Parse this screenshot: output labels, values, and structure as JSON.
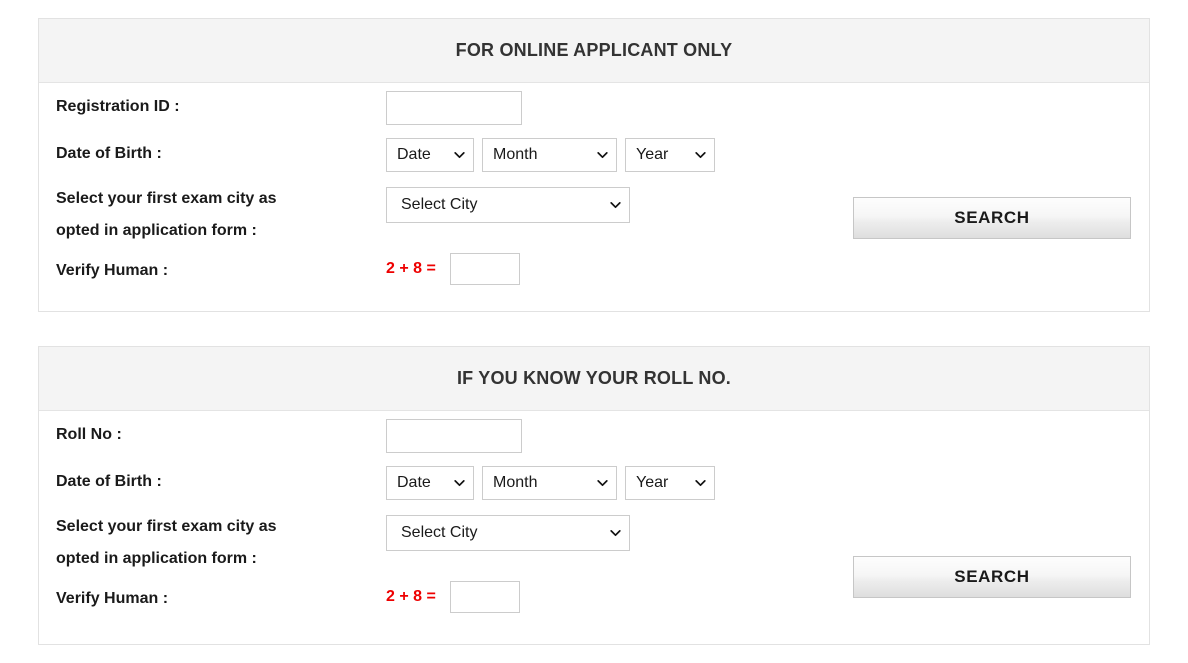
{
  "panels": [
    {
      "id": "online",
      "title": "FOR ONLINE APPLICANT ONLY",
      "id_label": "Registration ID :",
      "id_value": "",
      "id_placeholder": "",
      "dob_label": "Date of Birth :",
      "dob": {
        "date": "Date",
        "month": "Month",
        "year": "Year"
      },
      "city_label": "Select your first exam city as opted in application form :",
      "city_label_line1": "Select your first exam city as",
      "city_label_line2": "opted in application form :",
      "city_value": "Select City",
      "captcha_label": "Verify Human :",
      "captcha_question": "2 + 8 =",
      "captcha_value": "",
      "search_label": "SEARCH"
    },
    {
      "id": "rollno",
      "title": "IF YOU KNOW YOUR ROLL NO.",
      "id_label": "Roll No :",
      "id_value": "",
      "id_placeholder": "",
      "dob_label": "Date of Birth :",
      "dob": {
        "date": "Date",
        "month": "Month",
        "year": "Year"
      },
      "city_label": "Select your first exam city as opted in application form :",
      "city_label_line1": "Select your first exam city as",
      "city_label_line2": "opted in application form :",
      "city_value": "Select City",
      "captcha_label": "Verify Human :",
      "captcha_question": "2 + 8 =",
      "captcha_value": "",
      "search_label": "SEARCH"
    }
  ],
  "colors": {
    "panel_header_bg": "#f4f4f4",
    "panel_border": "#e2e2e2",
    "title_text": "#333333",
    "label_text": "#1a1a1a",
    "captcha_text": "#ee0000",
    "input_border": "#cccccc",
    "button_text": "#1a1a1a"
  },
  "icons": {
    "chevron_down": "chevron-down-icon"
  }
}
